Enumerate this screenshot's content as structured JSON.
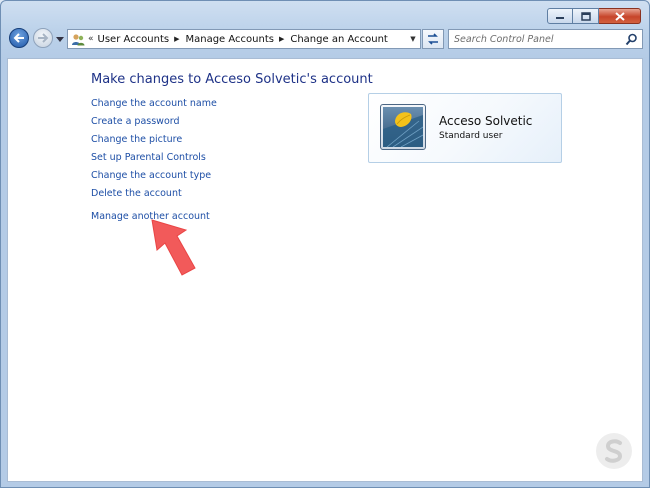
{
  "window": {
    "controls": {
      "minimize": "minimize",
      "maximize": "maximize",
      "close": "close"
    }
  },
  "navbar": {
    "breadcrumbs": [
      "User Accounts",
      "Manage Accounts",
      "Change an Account"
    ],
    "overflow_chevron": "«",
    "search_placeholder": "Search Control Panel"
  },
  "main": {
    "title": "Make changes to Acceso Solvetic's account",
    "links": [
      "Change the account name",
      "Create a password",
      "Change the picture",
      "Set up Parental Controls",
      "Change the account type",
      "Delete the account",
      "Manage another account"
    ],
    "account": {
      "name": "Acceso Solvetic",
      "type": "Standard user"
    }
  },
  "colors": {
    "link": "#1e4fa6",
    "title": "#1e3287",
    "arrow": "#f25a5a",
    "close_button": "#c7452b"
  },
  "icons": [
    "back-icon",
    "forward-icon",
    "recent-pages-icon",
    "user-accounts-icon",
    "refresh-icon",
    "search-icon",
    "watermark-logo-icon"
  ]
}
